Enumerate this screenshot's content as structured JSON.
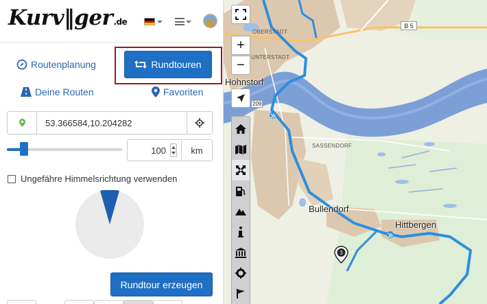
{
  "header": {
    "logo_text": "Kurv",
    "logo_mid": "ger",
    "logo_tld": ".de",
    "language_flag": "german-flag-icon",
    "menu_icon": "hamburger-icon"
  },
  "nav": {
    "routenplanung": "Routenplanung",
    "rundtouren": "Rundtouren",
    "deine_routen": "Deine Routen",
    "favoriten": "Favoriten"
  },
  "form": {
    "coordinates_value": "53.366584,10.204282",
    "distance_value": "100",
    "distance_unit": "km",
    "distance_slider_fraction": 0.15,
    "direction_label": "Ungefähre Himmelsrichtung verwenden",
    "direction_checked": false,
    "create_button": "Rundtour erzeugen"
  },
  "map": {
    "labels": {
      "oberstadt": "OBERSTADT",
      "unterstadt": "UNTERSTADT",
      "hohnstorf": "Hohnstorf",
      "sassendorf": "SASSENDORF",
      "bullendorf": "Bullendorf",
      "hittbergen": "Hittbergen",
      "b5": "B 5",
      "road_209": "209"
    },
    "badge_number": "3",
    "controls": {
      "fullscreen": "+",
      "zoom_in": "+",
      "zoom_out": "−"
    },
    "toolbar_icons": [
      "home-icon",
      "map-icon",
      "arrows-icon",
      "fuel-icon",
      "mountain-icon",
      "info-icon",
      "museum-icon",
      "gear-icon",
      "flag-icon"
    ],
    "colors": {
      "route": "#2b8fe0",
      "river": "#7c9fd6",
      "land": "#efefe6",
      "town": "#dcc8ae",
      "accent": "#1f6fc4"
    }
  }
}
